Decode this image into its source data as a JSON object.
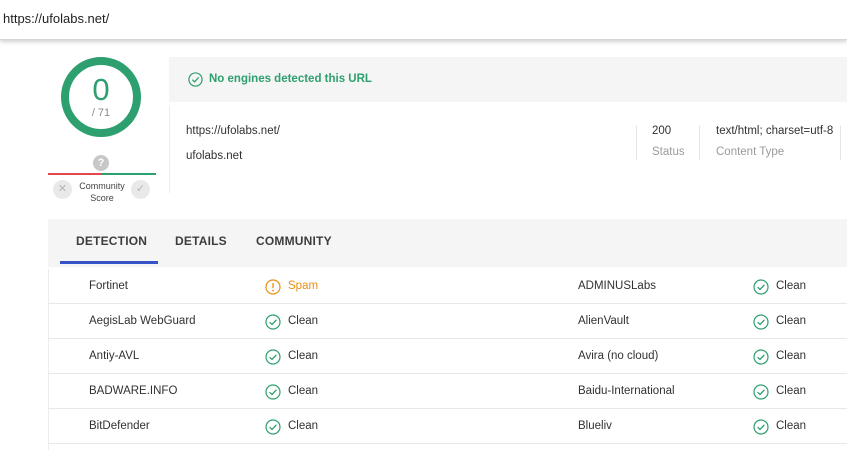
{
  "browser": {
    "url": "https://ufolabs.net/"
  },
  "score": {
    "detections": "0",
    "total": "/ 71",
    "ring_color": "#2e9f6e"
  },
  "community": {
    "question": "?",
    "label": "Community Score"
  },
  "banner": {
    "message": "No engines detected this URL",
    "color": "#2e9f6e"
  },
  "info": {
    "url": "https://ufolabs.net/",
    "host": "ufolabs.net",
    "status_value": "200",
    "status_label": "Status",
    "content_type_value": "text/html; charset=utf-8",
    "content_type_label": "Content Type"
  },
  "tabs": [
    {
      "label": "DETECTION",
      "active": true
    },
    {
      "label": "DETAILS",
      "active": false
    },
    {
      "label": "COMMUNITY",
      "active": false
    }
  ],
  "detections": [
    {
      "left": {
        "engine": "Fortinet",
        "result": "Spam",
        "status": "spam"
      },
      "right": {
        "engine": "ADMINUSLabs",
        "result": "Clean",
        "status": "clean"
      }
    },
    {
      "left": {
        "engine": "AegisLab WebGuard",
        "result": "Clean",
        "status": "clean"
      },
      "right": {
        "engine": "AlienVault",
        "result": "Clean",
        "status": "clean"
      }
    },
    {
      "left": {
        "engine": "Antiy-AVL",
        "result": "Clean",
        "status": "clean"
      },
      "right": {
        "engine": "Avira (no cloud)",
        "result": "Clean",
        "status": "clean"
      }
    },
    {
      "left": {
        "engine": "BADWARE.INFO",
        "result": "Clean",
        "status": "clean"
      },
      "right": {
        "engine": "Baidu-International",
        "result": "Clean",
        "status": "clean"
      }
    },
    {
      "left": {
        "engine": "BitDefender",
        "result": "Clean",
        "status": "clean"
      },
      "right": {
        "engine": "Blueliv",
        "result": "Clean",
        "status": "clean"
      }
    }
  ],
  "colors": {
    "clean": "#2e9f6e",
    "spam": "#e88e14",
    "accent": "#3553c7"
  },
  "icons": {
    "clean": "check-circle-icon",
    "spam": "info-circle-icon"
  }
}
